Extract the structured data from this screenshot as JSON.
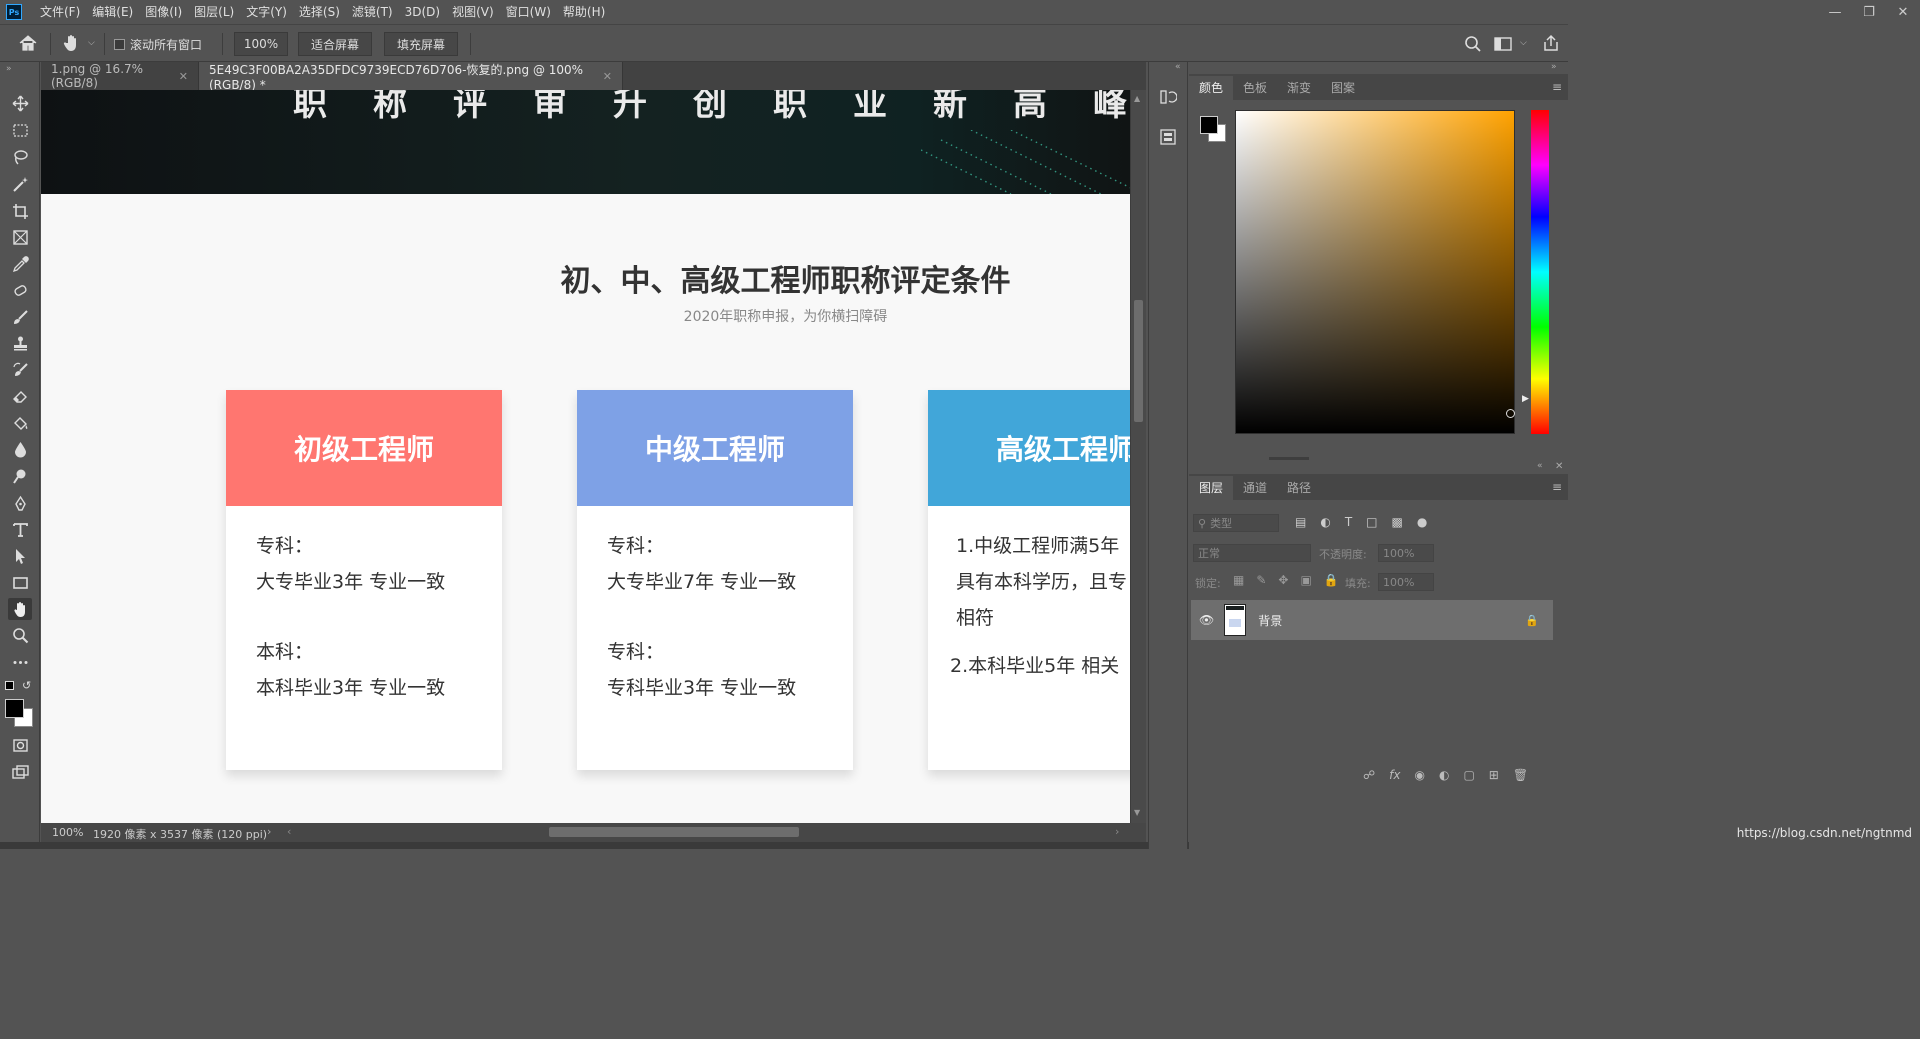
{
  "app": {
    "menus": [
      "文件(F)",
      "编辑(E)",
      "图像(I)",
      "图层(L)",
      "文字(Y)",
      "选择(S)",
      "滤镜(T)",
      "3D(D)",
      "视图(V)",
      "窗口(W)",
      "帮助(H)"
    ]
  },
  "options": {
    "scroll_all_label": "滚动所有窗口",
    "zoom_value": "100%",
    "fit_screen_label": "适合屏幕",
    "fill_screen_label": "填充屏幕"
  },
  "tabs": [
    {
      "label": "1.png @ 16.7%(RGB/8)"
    },
    {
      "label": "5E49C3F00BA2A35DFDC9739ECD76D706-恢复的.png @ 100%(RGB/8) *"
    }
  ],
  "canvas": {
    "banner_text": "职称评审升创职业新高峰",
    "title": "初、中、高级工程师职称评定条件",
    "subtitle": "2020年职称申报，为你横扫障碍",
    "cards": [
      {
        "header": "初级工程师",
        "color": "#ff7670",
        "lines": [
          "专科：",
          "大专毕业3年 专业一致",
          "",
          "本科：",
          "本科毕业3年 专业一致"
        ]
      },
      {
        "header": "中级工程师",
        "color": "#7ea1e6",
        "lines": [
          "专科：",
          "大专毕业7年 专业一致",
          "",
          "专科：",
          "专科毕业3年 专业一致"
        ]
      },
      {
        "header": "高级工程师",
        "color": "#41a6d9",
        "lines": [
          "1.中级工程师满5年",
          "具有本科学历，且专",
          "相符",
          "",
          "2.本科毕业5年 相关"
        ]
      }
    ]
  },
  "status": {
    "zoom": "100%",
    "doc_info": "1920 像素 x 3537 像素 (120 ppi)"
  },
  "color_panel": {
    "tabs": [
      "颜色",
      "色板",
      "渐变",
      "图案"
    ],
    "foreground": "#000000",
    "background": "#ffffff"
  },
  "layers_panel": {
    "tabs": [
      "图层",
      "通道",
      "路径"
    ],
    "filter_placeholder": "类型",
    "blend_mode": "正常",
    "opacity_label": "不透明度:",
    "opacity_value": "100%",
    "lock_label": "锁定:",
    "fill_label": "填充:",
    "fill_value": "100%",
    "layers": [
      {
        "name": "背景",
        "visible": true,
        "locked": true
      }
    ]
  },
  "watermark": "https://blog.csdn.net/ngtnmd"
}
